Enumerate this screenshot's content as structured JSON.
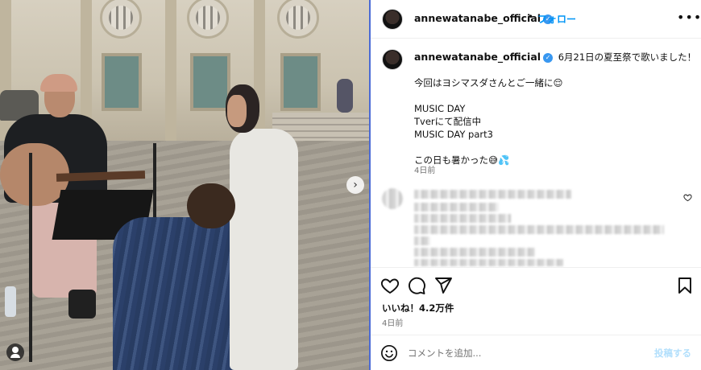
{
  "header": {
    "username": "annewatanabe_official",
    "verified_mark": "✓",
    "separator": "•",
    "follow_label": "フォロー",
    "more_label": "•••"
  },
  "caption": {
    "username": "annewatanabe_official",
    "verified_mark": "✓",
    "lines": [
      "6月21日の夏至祭で歌いました！",
      "",
      "今回はヨシマスダさんとご一緒に😌",
      "",
      "MUSIC DAY",
      "Tverにて配信中",
      "MUSIC DAY part3",
      "",
      "この日も暑かった😅💦"
    ],
    "time_ago": "4日前"
  },
  "media": {
    "next_icon": "chevron-right-icon",
    "next_glyph": "›",
    "tag_icon": "user-tag-icon"
  },
  "actions": {
    "like_icon": "heart-icon",
    "comment_icon": "comment-icon",
    "share_icon": "share-icon",
    "save_icon": "bookmark-icon",
    "likes_text": "いいね！4.2万件",
    "date_text": "4日前"
  },
  "comment_box": {
    "emoji_icon": "emoji-icon",
    "placeholder": "コメントを追加...",
    "post_label": "投稿する"
  },
  "colors": {
    "accent": "#0095f6",
    "post_disabled": "#b2dffc",
    "verified": "#3897f0",
    "muted": "#737373"
  }
}
